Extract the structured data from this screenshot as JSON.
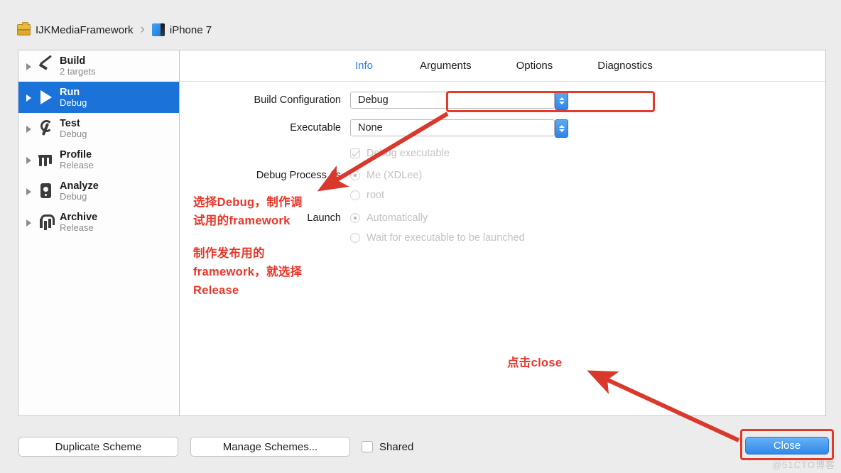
{
  "breadcrumb": {
    "project": "IJKMediaFramework",
    "separator": "›",
    "device": "iPhone 7",
    "project_icon": "briefcase-icon",
    "device_icon": "device-icon"
  },
  "sidebar": {
    "items": [
      {
        "name": "Build",
        "sub": "2 targets",
        "icon": "hammer-icon",
        "selected": false
      },
      {
        "name": "Run",
        "sub": "Debug",
        "icon": "play-icon",
        "selected": true
      },
      {
        "name": "Test",
        "sub": "Debug",
        "icon": "wrench-icon",
        "selected": false
      },
      {
        "name": "Profile",
        "sub": "Release",
        "icon": "gauge-icon",
        "selected": false
      },
      {
        "name": "Analyze",
        "sub": "Debug",
        "icon": "analyze-icon",
        "selected": false
      },
      {
        "name": "Archive",
        "sub": "Release",
        "icon": "archive-icon",
        "selected": false
      }
    ]
  },
  "tabs": [
    {
      "label": "Info",
      "active": true
    },
    {
      "label": "Arguments",
      "active": false
    },
    {
      "label": "Options",
      "active": false
    },
    {
      "label": "Diagnostics",
      "active": false
    }
  ],
  "form": {
    "build_configuration": {
      "label": "Build Configuration",
      "value": "Debug",
      "highlighted": true
    },
    "executable": {
      "label": "Executable",
      "value": "None"
    },
    "debug_executable": {
      "label": "Debug executable",
      "checked": true,
      "enabled": false
    },
    "debug_process_as": {
      "label": "Debug Process As",
      "options": [
        {
          "label": "Me (XDLee)",
          "selected": true
        },
        {
          "label": "root",
          "selected": false
        }
      ]
    },
    "launch": {
      "label": "Launch",
      "options": [
        {
          "label": "Automatically",
          "selected": true
        },
        {
          "label": "Wait for executable to be launched",
          "selected": false
        }
      ]
    }
  },
  "annotations": {
    "config_note": "选择Debug，制作调\n试用的framework",
    "release_note": "制作发布用的\nframework，就选择\nRelease",
    "close_note": "点击close",
    "color": "#e8372a"
  },
  "footer": {
    "duplicate_scheme": "Duplicate Scheme",
    "manage_schemes": "Manage Schemes...",
    "shared_label": "Shared",
    "shared_checked": false,
    "close_button": "Close"
  },
  "watermark": "@51CTO博客",
  "colors": {
    "accent_blue": "#1b72d8",
    "tab_active": "#2d7fe0",
    "annotation_red": "#e8372a",
    "window_bg": "#ececec",
    "panel_bg": "#ffffff"
  }
}
